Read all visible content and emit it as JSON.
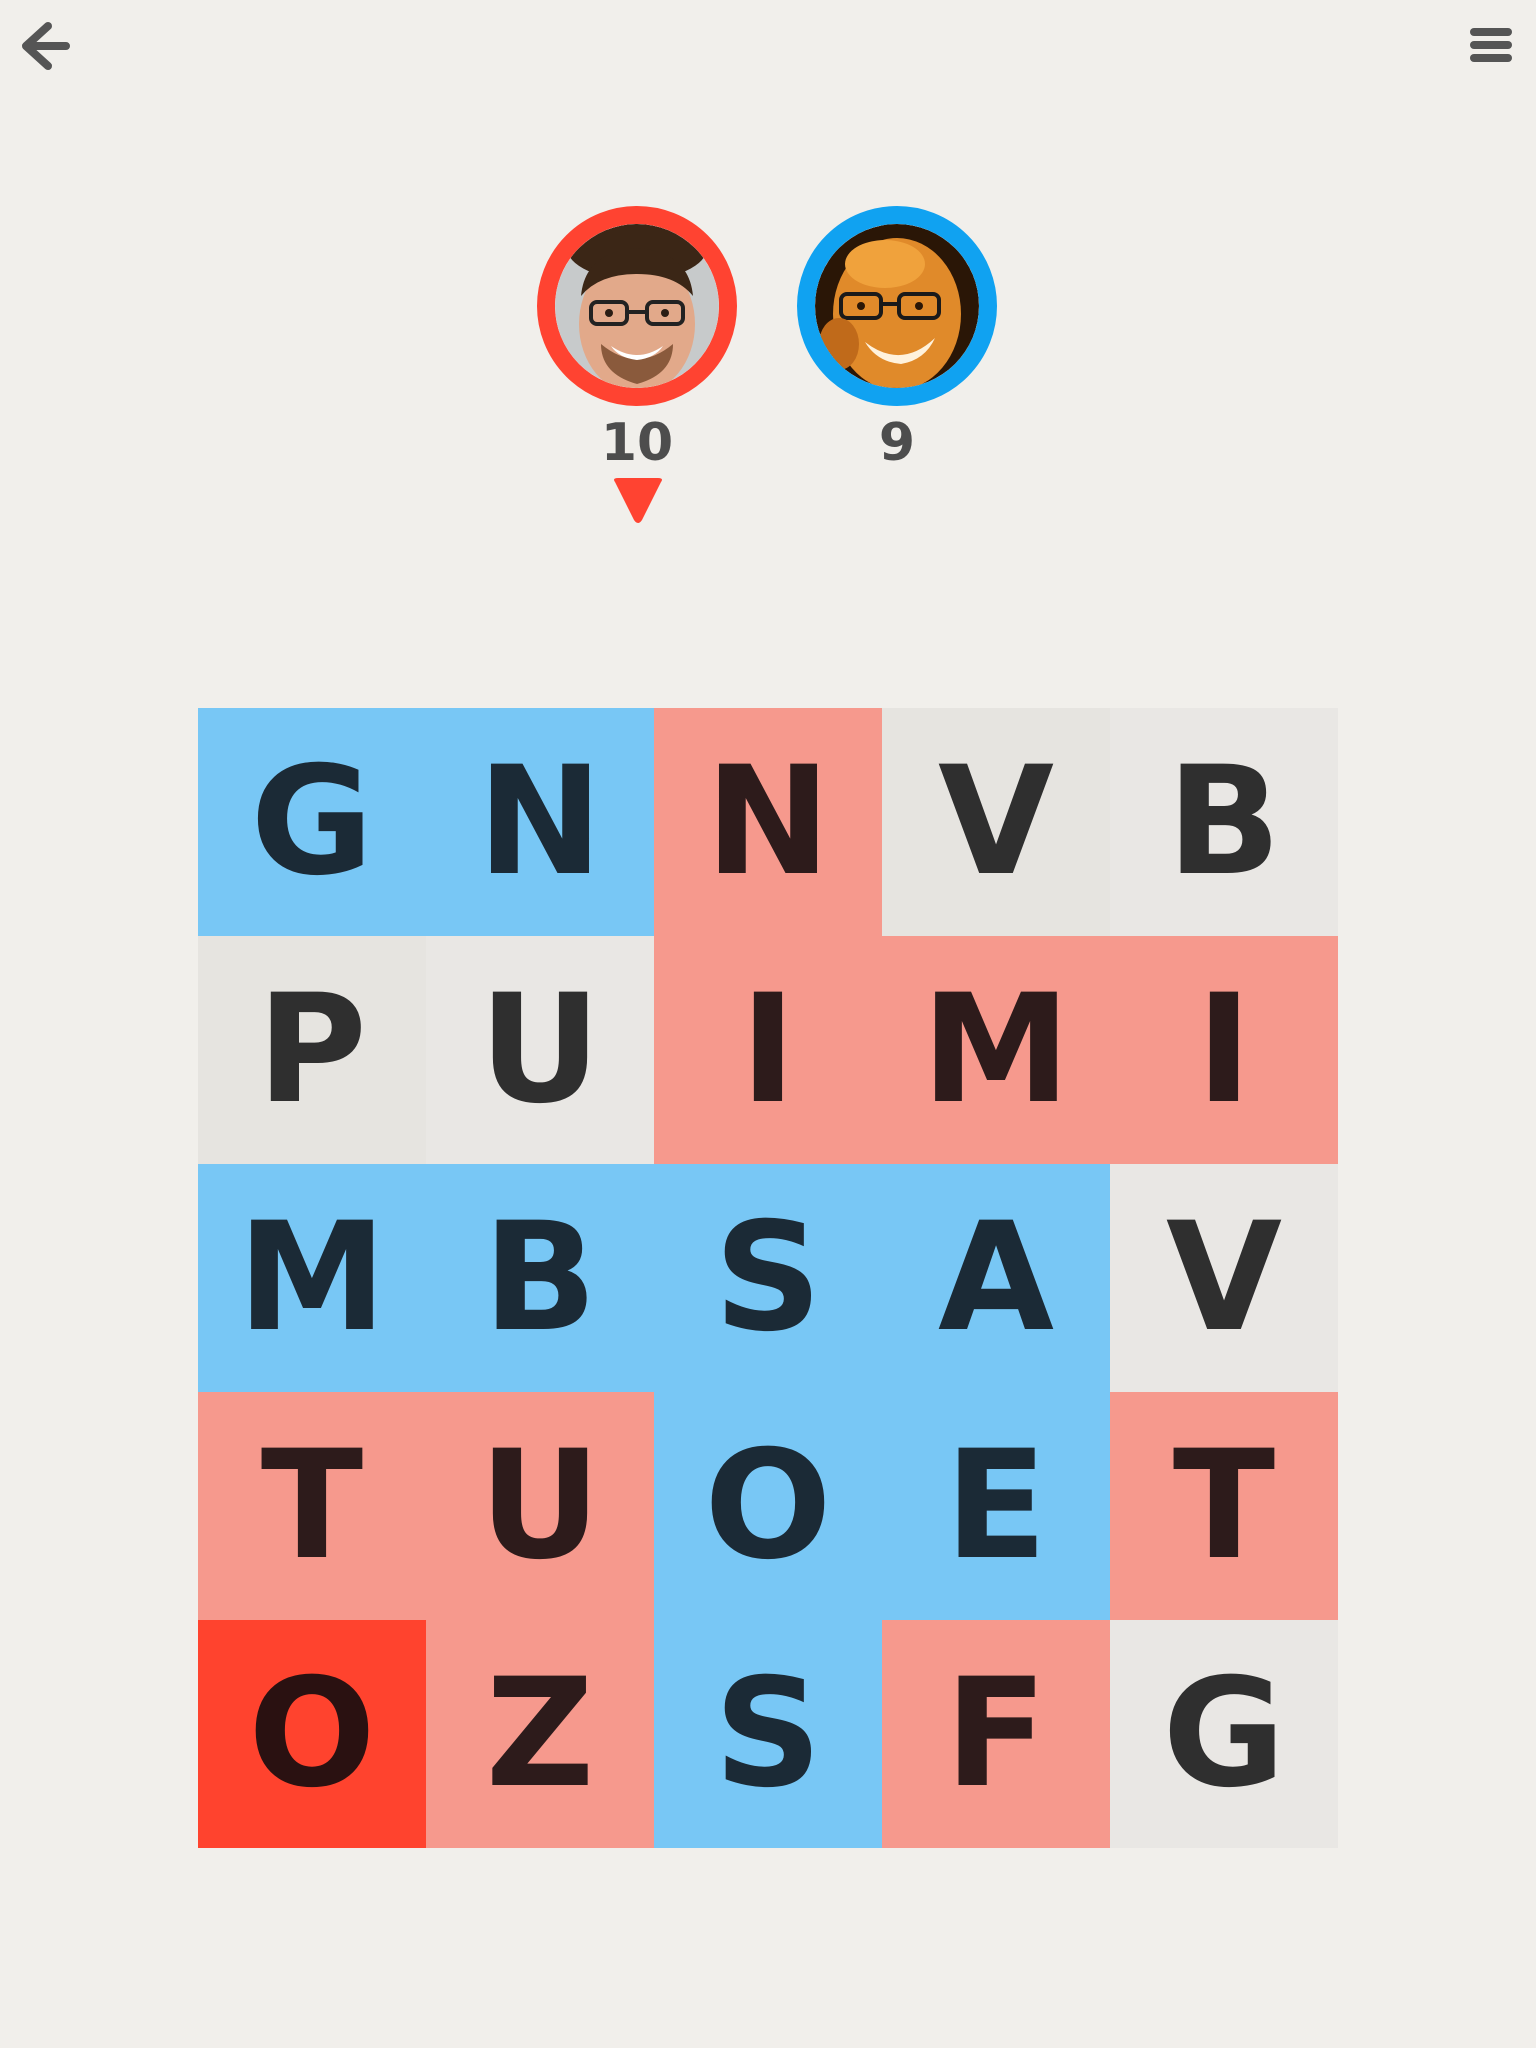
{
  "header": {
    "back_icon": "arrow-left-icon",
    "menu_icon": "hamburger-menu-icon",
    "icon_color": "#555555"
  },
  "players": [
    {
      "side": "red",
      "ring_color": "#ff4331",
      "score": "10",
      "has_turn": true
    },
    {
      "side": "blue",
      "ring_color": "#10a2f1",
      "score": "9",
      "has_turn": false
    }
  ],
  "turn_indicator": {
    "color": "#ff4331",
    "icon": "triangle-down-icon"
  },
  "board": {
    "colors": {
      "blue": "#78c7f5",
      "red": "#f6998d",
      "red-defended": "#ff432e",
      "neutral": "#e9e7e4"
    },
    "rows": [
      [
        {
          "letter": "G",
          "owner": "blue"
        },
        {
          "letter": "N",
          "owner": "blue"
        },
        {
          "letter": "N",
          "owner": "red"
        },
        {
          "letter": "V",
          "owner": "neutral"
        },
        {
          "letter": "B",
          "owner": "neutral"
        }
      ],
      [
        {
          "letter": "P",
          "owner": "neutral"
        },
        {
          "letter": "U",
          "owner": "neutral"
        },
        {
          "letter": "I",
          "owner": "red"
        },
        {
          "letter": "M",
          "owner": "red"
        },
        {
          "letter": "I",
          "owner": "red"
        }
      ],
      [
        {
          "letter": "M",
          "owner": "blue"
        },
        {
          "letter": "B",
          "owner": "blue"
        },
        {
          "letter": "S",
          "owner": "blue"
        },
        {
          "letter": "A",
          "owner": "blue"
        },
        {
          "letter": "V",
          "owner": "neutral"
        }
      ],
      [
        {
          "letter": "T",
          "owner": "red"
        },
        {
          "letter": "U",
          "owner": "red"
        },
        {
          "letter": "O",
          "owner": "blue"
        },
        {
          "letter": "E",
          "owner": "blue"
        },
        {
          "letter": "T",
          "owner": "red"
        }
      ],
      [
        {
          "letter": "O",
          "owner": "red-defended"
        },
        {
          "letter": "Z",
          "owner": "red"
        },
        {
          "letter": "S",
          "owner": "blue"
        },
        {
          "letter": "F",
          "owner": "red"
        },
        {
          "letter": "G",
          "owner": "neutral"
        }
      ]
    ]
  }
}
